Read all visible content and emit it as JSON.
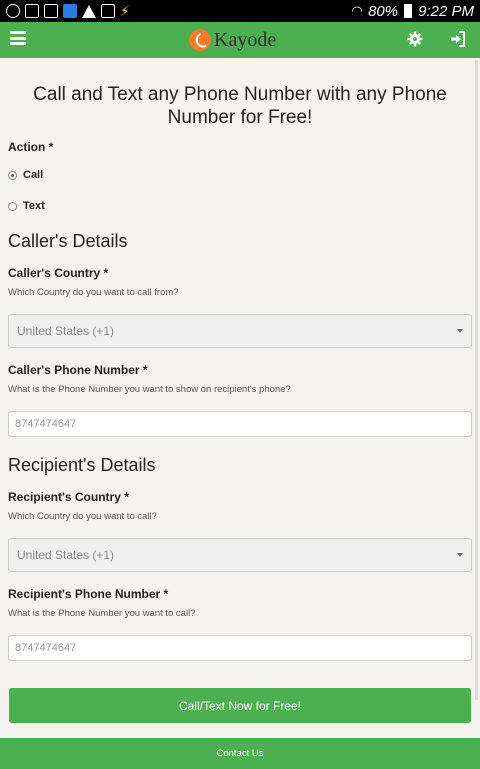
{
  "status_bar": {
    "battery": "80%",
    "time": "9:22 PM"
  },
  "app_bar": {
    "logo_text": "Kayode",
    "colors": {
      "primary": "#4caf50",
      "logo": "#f57c2b"
    }
  },
  "hero": {
    "title": "Call and Text any Phone Number with any Phone Number for Free!"
  },
  "action": {
    "label": "Action *",
    "options": [
      "Call",
      "Text"
    ],
    "selected": "Call"
  },
  "caller": {
    "section_title": "Caller's Details",
    "country_label": "Caller's Country *",
    "country_help": "Which Country do you want to call from?",
    "country_value": "United States (+1)",
    "phone_label": "Caller's Phone Number *",
    "phone_help": "What is the Phone Number you want to show on recipient's phone?",
    "phone_placeholder": "8747474647"
  },
  "recipient": {
    "section_title": "Recipient's Details",
    "country_label": "Recipient's Country *",
    "country_help": "Which Country do you want to call?",
    "country_value": "United States (+1)",
    "phone_label": "Recipient's Phone Number *",
    "phone_help": "What is the Phone Number you want to call?",
    "phone_placeholder": "8747474647"
  },
  "submit": {
    "label": "Call/Text Now for Free!"
  },
  "footer": {
    "link": "Contact Us"
  }
}
